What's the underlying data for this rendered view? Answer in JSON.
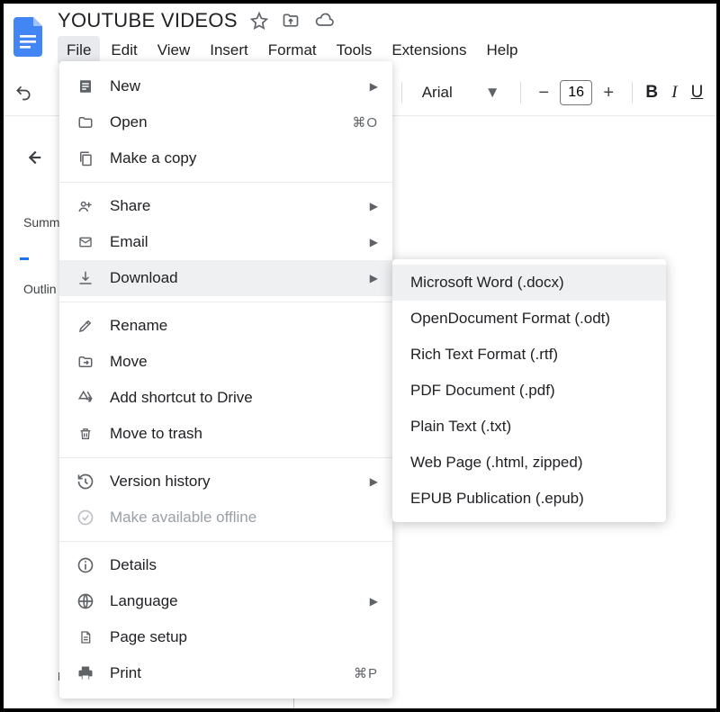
{
  "doc": {
    "title": "YOUTUBE VIDEOS"
  },
  "menubar": [
    "File",
    "Edit",
    "View",
    "Insert",
    "Format",
    "Tools",
    "Extensions",
    "Help"
  ],
  "toolbar": {
    "font": "Arial",
    "size": "16"
  },
  "outline": {
    "summary": "Summ",
    "outline": "Outlin",
    "ie": "IE"
  },
  "file_menu": {
    "new": "New",
    "open": "Open",
    "open_shortcut": "⌘O",
    "copy": "Make a copy",
    "share": "Share",
    "email": "Email",
    "download": "Download",
    "rename": "Rename",
    "move": "Move",
    "shortcut": "Add shortcut to Drive",
    "trash": "Move to trash",
    "version": "Version history",
    "offline": "Make available offline",
    "details": "Details",
    "language": "Language",
    "pagesetup": "Page setup",
    "print": "Print",
    "print_shortcut": "⌘P"
  },
  "download_menu": [
    "Microsoft Word (.docx)",
    "OpenDocument Format (.odt)",
    "Rich Text Format (.rtf)",
    "PDF Document (.pdf)",
    "Plain Text (.txt)",
    "Web Page (.html, zipped)",
    "EPUB Publication (.epub)"
  ]
}
